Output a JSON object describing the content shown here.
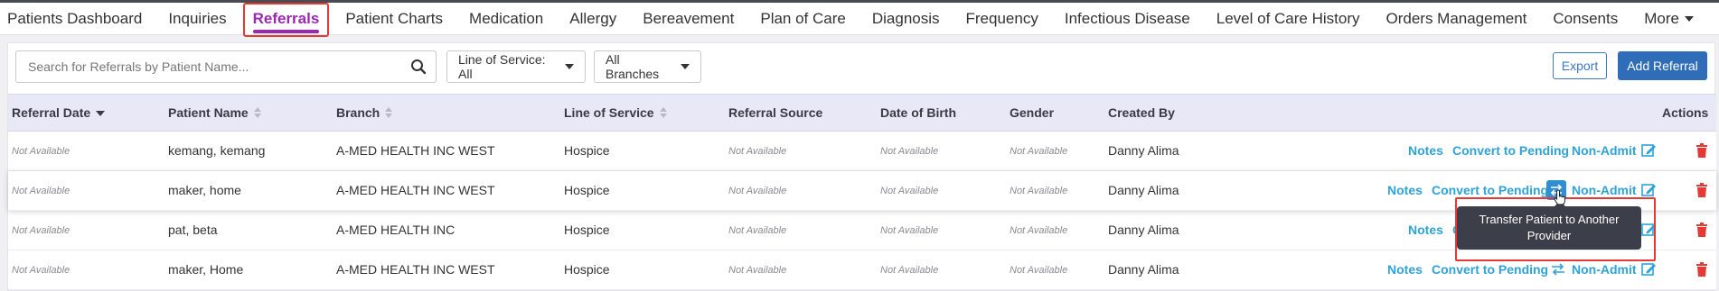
{
  "nav": {
    "items": [
      {
        "label": "Patients Dashboard",
        "active": false
      },
      {
        "label": "Inquiries",
        "active": false
      },
      {
        "label": "Referrals",
        "active": true
      },
      {
        "label": "Patient Charts",
        "active": false
      },
      {
        "label": "Medication",
        "active": false
      },
      {
        "label": "Allergy",
        "active": false
      },
      {
        "label": "Bereavement",
        "active": false
      },
      {
        "label": "Plan of Care",
        "active": false
      },
      {
        "label": "Diagnosis",
        "active": false
      },
      {
        "label": "Frequency",
        "active": false
      },
      {
        "label": "Infectious Disease",
        "active": false
      },
      {
        "label": "Level of Care History",
        "active": false
      },
      {
        "label": "Orders Management",
        "active": false
      },
      {
        "label": "Consents",
        "active": false
      }
    ],
    "more_label": "More"
  },
  "toolbar": {
    "search_placeholder": "Search for Referrals by Patient Name...",
    "search_value": "",
    "line_of_service": "Line of Service: All",
    "branches": "All Branches",
    "export_label": "Export",
    "add_label": "Add Referral"
  },
  "table": {
    "headers": {
      "referral_date": "Referral Date",
      "patient_name": "Patient Name",
      "branch": "Branch",
      "line_of_service": "Line of Service",
      "referral_source": "Referral Source",
      "dob": "Date of Birth",
      "gender": "Gender",
      "created_by": "Created By",
      "actions": "Actions"
    },
    "rows": [
      {
        "referral_date": "Not Available",
        "patient_name": "kemang, kemang",
        "branch": "A-MED HEALTH INC WEST",
        "line_of_service": "Hospice",
        "referral_source": "Not Available",
        "dob": "Not Available",
        "gender": "Not Available",
        "created_by": "Danny Alima"
      },
      {
        "referral_date": "Not Available",
        "patient_name": "maker, home",
        "branch": "A-MED HEALTH INC WEST",
        "line_of_service": "Hospice",
        "referral_source": "Not Available",
        "dob": "Not Available",
        "gender": "Not Available",
        "created_by": "Danny Alima"
      },
      {
        "referral_date": "Not Available",
        "patient_name": "pat, beta",
        "branch": "A-MED HEALTH INC",
        "line_of_service": "Hospice",
        "referral_source": "Not Available",
        "dob": "Not Available",
        "gender": "Not Available",
        "created_by": "Danny Alima"
      },
      {
        "referral_date": "Not Available",
        "patient_name": "maker, Home",
        "branch": "A-MED HEALTH INC WEST",
        "line_of_service": "Hospice",
        "referral_source": "Not Available",
        "dob": "Not Available",
        "gender": "Not Available",
        "created_by": "Danny Alima"
      }
    ],
    "actions": {
      "notes": "Notes",
      "convert": "Convert to Pending",
      "non_admit": "Non-Admit"
    }
  },
  "tooltip": {
    "text": "Transfer Patient to Another Provider"
  },
  "colors": {
    "accent": "#9c27b0",
    "link": "#2fa3d6",
    "primary_button": "#2f6db8",
    "delete": "#e53935",
    "highlight_box": "#e53935"
  }
}
